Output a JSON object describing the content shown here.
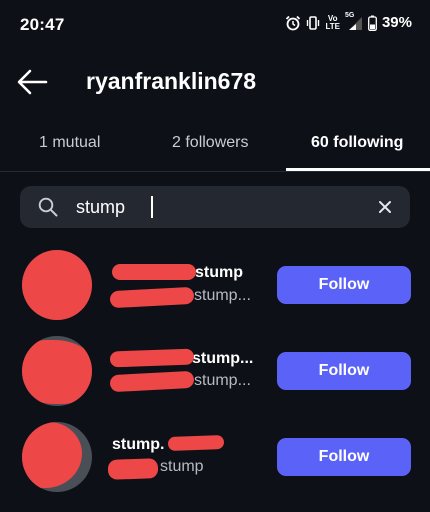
{
  "status_bar": {
    "time": "20:47",
    "lte_top": "Vo",
    "lte_bottom": "LTE",
    "network": "5G",
    "battery": "39%",
    "icons": [
      "alarm-icon",
      "vibrate-icon",
      "volte-icon",
      "signal-icon",
      "battery-icon"
    ]
  },
  "header": {
    "username": "ryanfranklin678",
    "back_icon": "arrow-left-icon"
  },
  "tabs": [
    {
      "label": "1 mutual",
      "active": false
    },
    {
      "label": "2 followers",
      "active": false
    },
    {
      "label": "60 following",
      "active": true
    }
  ],
  "search": {
    "query": "stump",
    "search_icon": "search-icon",
    "clear_icon": "close-icon"
  },
  "results": [
    {
      "name": "stump",
      "subtitle": "stump...",
      "button": "Follow"
    },
    {
      "name": "stump...",
      "subtitle": "stump...",
      "button": "Follow"
    },
    {
      "name": "stump.",
      "subtitle": "stump",
      "button": "Follow"
    }
  ],
  "colors": {
    "background": "#0d1016",
    "search_bg": "#242830",
    "follow_button": "#5b62f8",
    "redaction": "#ee4747"
  }
}
